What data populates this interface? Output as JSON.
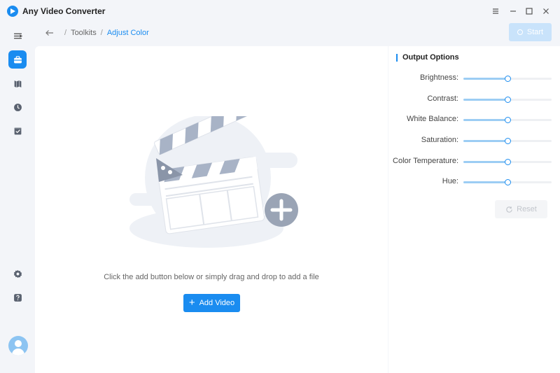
{
  "app": {
    "title": "Any Video Converter"
  },
  "breadcrumb": {
    "parent": "Toolkits",
    "current": "Adjust Color"
  },
  "toolbar": {
    "start_label": "Start"
  },
  "rail": {
    "icons": [
      "toolbox-icon",
      "library-icon",
      "history-icon",
      "tasks-icon",
      "settings-icon",
      "help-icon"
    ],
    "active": "toolbox-icon"
  },
  "main": {
    "hint": "Click the add button below or simply drag and drop to add a file",
    "add_label": "Add Video",
    "add_symbol": "+"
  },
  "options": {
    "title": "Output Options",
    "sliders": [
      {
        "label": "Brightness:",
        "value": 0.5
      },
      {
        "label": "Contrast:",
        "value": 0.5
      },
      {
        "label": "White Balance:",
        "value": 0.5
      },
      {
        "label": "Saturation:",
        "value": 0.5
      },
      {
        "label": "Color Temperature:",
        "value": 0.5
      },
      {
        "label": "Hue:",
        "value": 0.5
      }
    ],
    "reset_label": "Reset"
  },
  "colors": {
    "accent": "#1a8cf0",
    "disabled": "#c9e3fb"
  }
}
